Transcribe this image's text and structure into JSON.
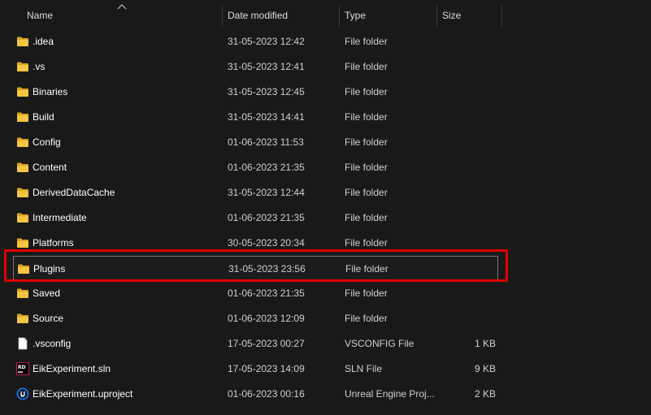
{
  "columns": {
    "name": "Name",
    "date_modified": "Date modified",
    "type": "Type",
    "size": "Size"
  },
  "files": [
    {
      "name": ".idea",
      "date": "31-05-2023 12:42",
      "type": "File folder",
      "size": "",
      "icon": "folder-icon"
    },
    {
      "name": ".vs",
      "date": "31-05-2023 12:41",
      "type": "File folder",
      "size": "",
      "icon": "folder-icon"
    },
    {
      "name": "Binaries",
      "date": "31-05-2023 12:45",
      "type": "File folder",
      "size": "",
      "icon": "folder-icon"
    },
    {
      "name": "Build",
      "date": "31-05-2023 14:41",
      "type": "File folder",
      "size": "",
      "icon": "folder-icon"
    },
    {
      "name": "Config",
      "date": "01-06-2023 11:53",
      "type": "File folder",
      "size": "",
      "icon": "folder-icon"
    },
    {
      "name": "Content",
      "date": "01-06-2023 21:35",
      "type": "File folder",
      "size": "",
      "icon": "folder-icon"
    },
    {
      "name": "DerivedDataCache",
      "date": "31-05-2023 12:44",
      "type": "File folder",
      "size": "",
      "icon": "folder-icon"
    },
    {
      "name": "Intermediate",
      "date": "01-06-2023 21:35",
      "type": "File folder",
      "size": "",
      "icon": "folder-icon"
    },
    {
      "name": "Platforms",
      "date": "30-05-2023 20:34",
      "type": "File folder",
      "size": "",
      "icon": "folder-icon"
    },
    {
      "name": "Plugins",
      "date": "31-05-2023 23:56",
      "type": "File folder",
      "size": "",
      "icon": "folder-icon",
      "selected": true
    },
    {
      "name": "Saved",
      "date": "01-06-2023 21:35",
      "type": "File folder",
      "size": "",
      "icon": "folder-icon"
    },
    {
      "name": "Source",
      "date": "01-06-2023 12:09",
      "type": "File folder",
      "size": "",
      "icon": "folder-icon"
    },
    {
      "name": ".vsconfig",
      "date": "17-05-2023 00:27",
      "type": "VSCONFIG File",
      "size": "1 KB",
      "icon": "document-icon"
    },
    {
      "name": "EikExperiment.sln",
      "date": "17-05-2023 14:09",
      "type": "SLN File",
      "size": "9 KB",
      "icon": "rider-sln-icon"
    },
    {
      "name": "EikExperiment.uproject",
      "date": "01-06-2023 00:16",
      "type": "Unreal Engine Proj...",
      "size": "2 KB",
      "icon": "unreal-engine-icon"
    }
  ],
  "colors": {
    "background": "#191919",
    "folder": "#f4c542",
    "highlight": "#e00000"
  }
}
